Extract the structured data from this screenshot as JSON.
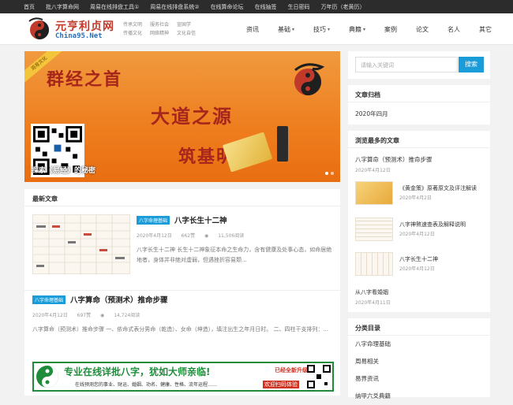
{
  "topbar": {
    "links": [
      "首页",
      "批八字算命网",
      "周易在线排盘工具①",
      "周易在线排盘系统②",
      "在线算命论坛",
      "在线抽签",
      "生日密码",
      "万年历（老黄历）"
    ]
  },
  "header": {
    "logo_title": "元亨利贞网",
    "logo_sub": "China95.Net",
    "slogans": [
      "传承文明",
      "服务社会",
      "宣国学",
      "传播文化",
      "网络精神",
      "文化自信"
    ],
    "nav": [
      {
        "label": "资讯",
        "dropdown": false
      },
      {
        "label": "基础",
        "dropdown": true
      },
      {
        "label": "技巧",
        "dropdown": true
      },
      {
        "label": "典籍",
        "dropdown": true
      },
      {
        "label": "案例",
        "dropdown": false
      },
      {
        "label": "论文",
        "dropdown": false
      },
      {
        "label": "名人",
        "dropdown": false
      },
      {
        "label": "其它",
        "dropdown": false
      }
    ]
  },
  "banner": {
    "ribbon": "周易文化",
    "line1": "群经之首",
    "line2": "大道之源",
    "line3": "筑基明德",
    "caption": "探索《易经》的秘密",
    "slide_count": 2,
    "active_slide": 1
  },
  "latest": {
    "heading": "最新文章",
    "posts": [
      {
        "tag": "八字命理基础",
        "title": "八字长生十二神",
        "date": "2020年4月12日",
        "likes": "662赞",
        "views": "11,506阅读",
        "excerpt": "八字长生十二神 长生十二神象征本命之生命力，含有健康及处事心态，如命居绝地者，身体并非绝对虚弱，但遇挫折容易颓..."
      },
      {
        "tag": "八字命理基础",
        "title": "八字算命（预测术）推命步骤",
        "date": "2020年4月12日",
        "likes": "697赞",
        "views": "14,724阅读",
        "excerpt": "八字算命（预测术）推命步骤 一、依命式表分男命（乾造）、女命（坤造），填注出生之年月日时。 二、四柱干支排列：..."
      }
    ],
    "ad": {
      "line1": "专业在线详批八字，犹如大师亲临!",
      "line2": "在线预测您的事业、财运、婚姻、功名、健康、性格、流年运程……",
      "badge1": "已经全新升级",
      "badge2": "欢迎扫码体验"
    }
  },
  "sidebar": {
    "search_placeholder": "请输入关键词",
    "search_button": "搜索",
    "archive_heading": "文章归档",
    "archive_items": [
      "2020年四月"
    ],
    "popular_heading": "浏览最多的文章",
    "popular": [
      {
        "title": "八字算命（预测术）推命步骤",
        "date": "2020年4月12日"
      },
      {
        "title": "《黄金策》原著原文及评注解读",
        "date": "2020年4月2日"
      },
      {
        "title": "八字神煞速查表及解释说明",
        "date": "2020年4月12日"
      },
      {
        "title": "八字长生十二神",
        "date": "2020年4月12日"
      },
      {
        "title": "从八字看婚姻",
        "date": "2020年4月11日"
      }
    ],
    "category_heading": "分类目录",
    "categories": [
      "八字命理基础",
      "周易相关",
      "易界资讯",
      "纳甲六爻典籍"
    ]
  },
  "colors": {
    "accent": "#1a9cd8",
    "banner": "#ee7d1e",
    "banner_text": "#a7261c",
    "topbar": "#2c2c2c"
  }
}
